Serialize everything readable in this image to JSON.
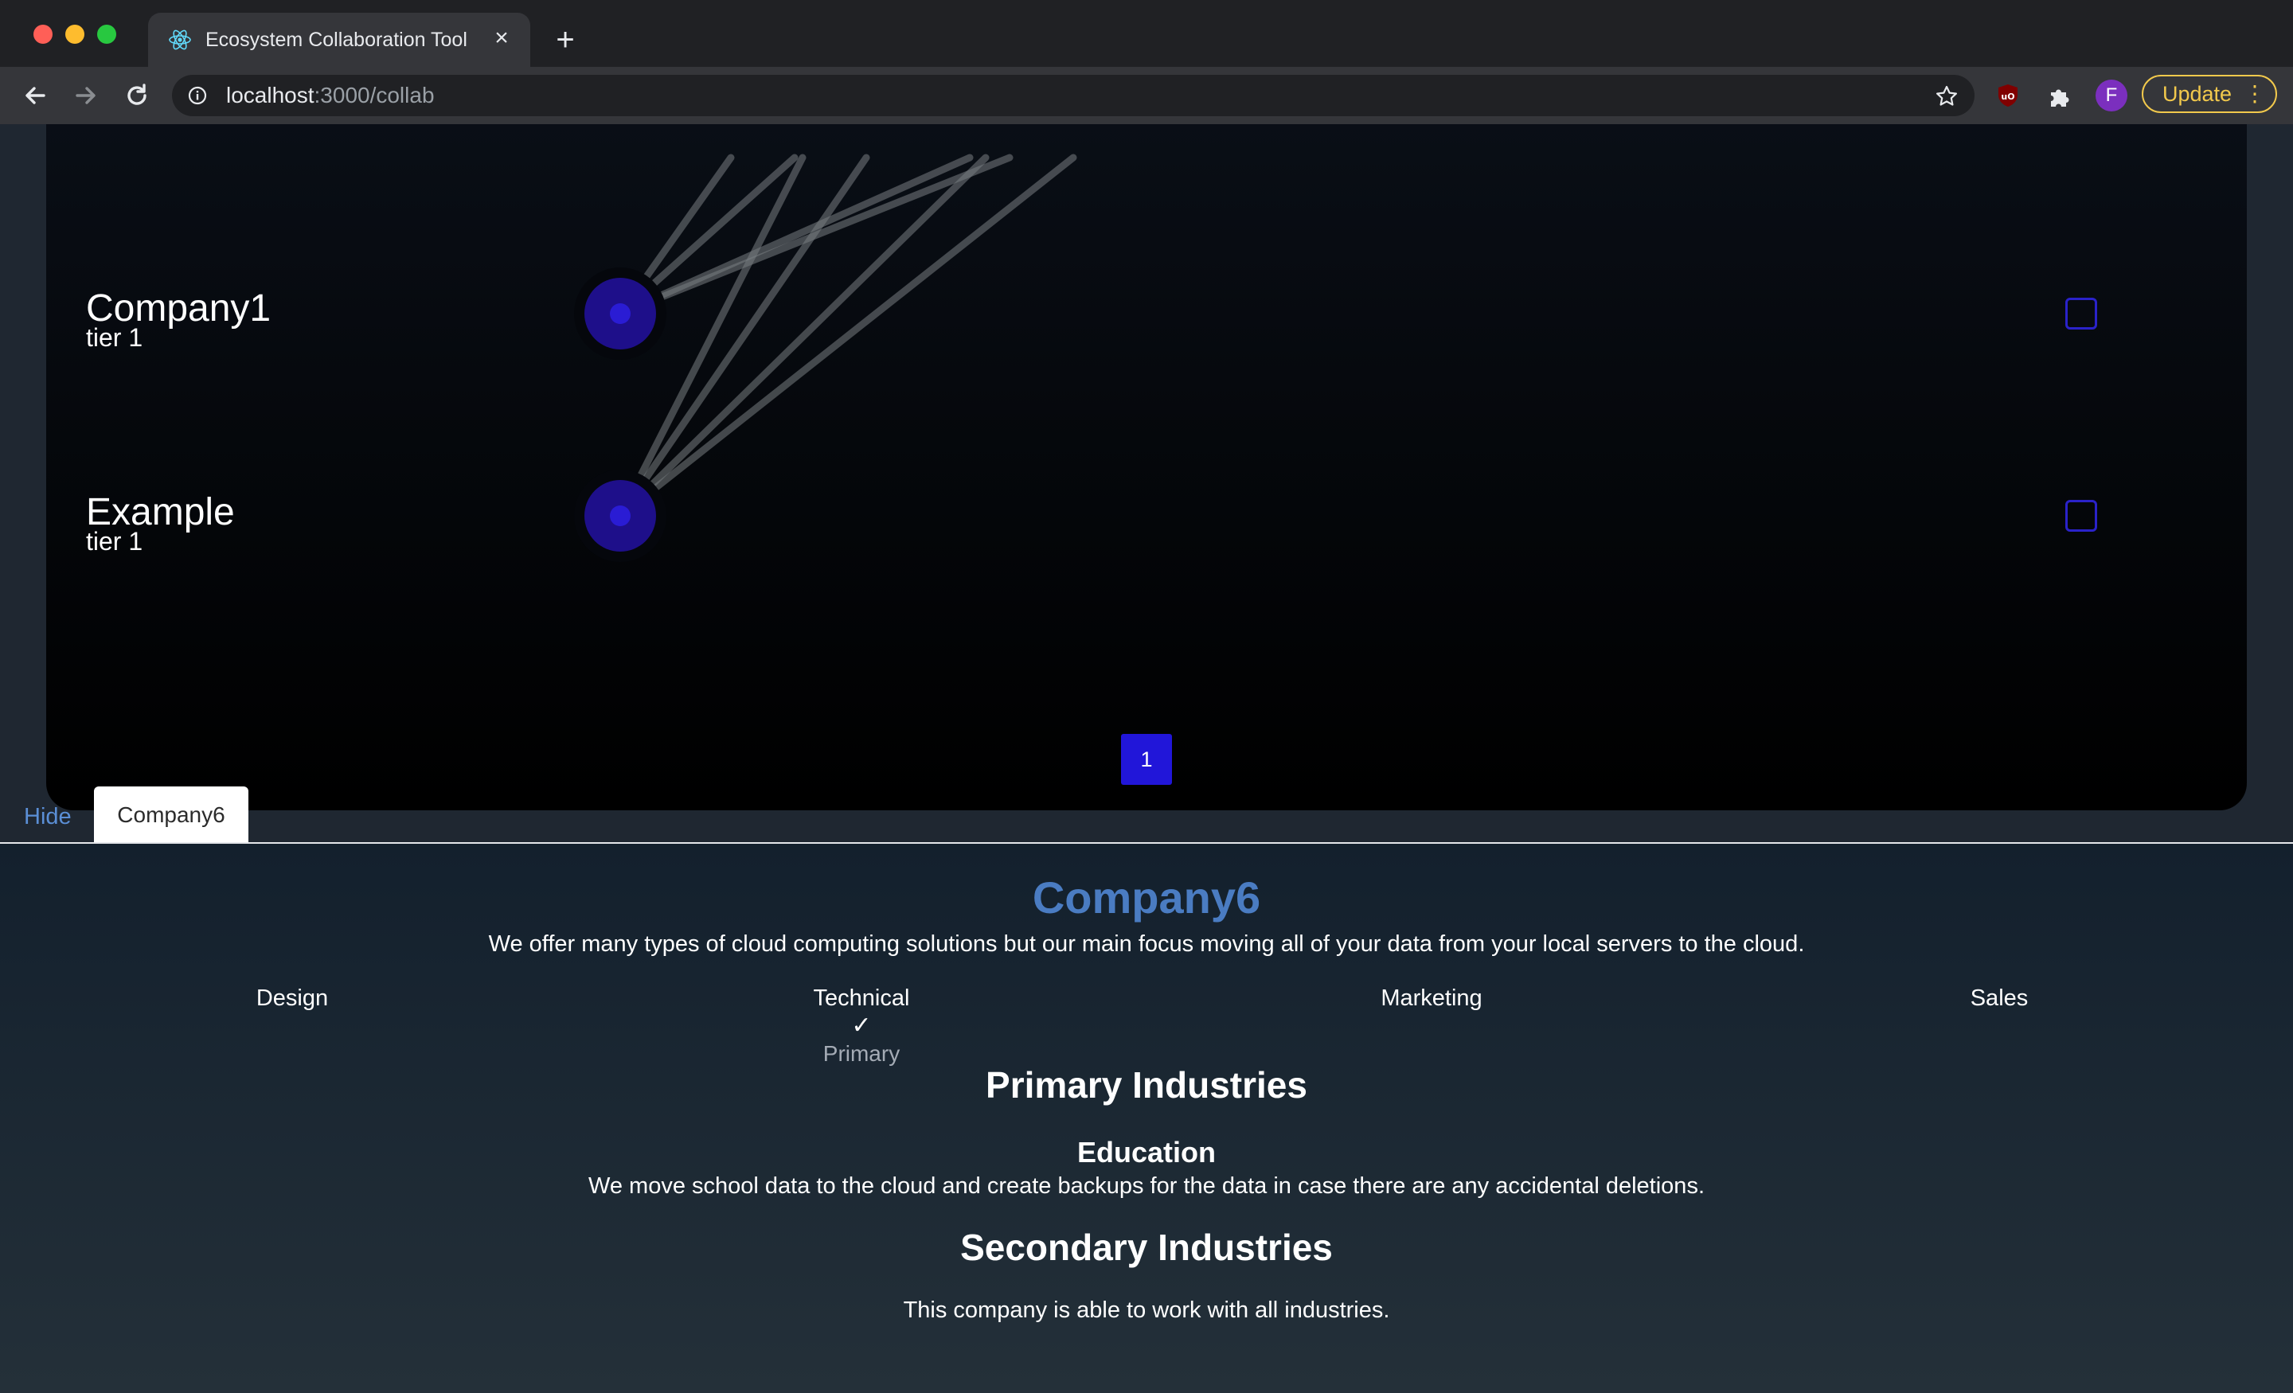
{
  "browser": {
    "tab_title": "Ecosystem Collaboration Tool",
    "url_host": "localhost",
    "url_rest": ":3000/collab",
    "profile_initial": "F",
    "update_label": "Update",
    "icons": [
      "react-favicon",
      "close-icon",
      "plus-icon",
      "back-arrow-icon",
      "forward-arrow-icon",
      "reload-icon",
      "info-icon",
      "star-icon",
      "ublock-icon",
      "puzzle-icon",
      "more-vert-icon"
    ]
  },
  "graph": {
    "nodes": [
      {
        "name": "Company1",
        "tier": "tier 1",
        "checked": false
      },
      {
        "name": "Example",
        "tier": "tier 1",
        "checked": false
      }
    ],
    "node_color": "#1e0f8a",
    "node_center_color": "#2a1cd4",
    "checkbox_color": "#2a22c9"
  },
  "pagination": {
    "pages": [
      "1"
    ],
    "current": "1",
    "color": "#2116d9"
  },
  "tabs": {
    "hide_label": "Hide",
    "active_tab": "Company6"
  },
  "company": {
    "name": "Company6",
    "description": "We offer many types of cloud computing solutions but our main focus moving all of your data from your local servers to the cloud.",
    "categories": [
      {
        "label": "Design",
        "checked": false,
        "note": ""
      },
      {
        "label": "Technical",
        "checked": true,
        "check": "✓",
        "note": "Primary"
      },
      {
        "label": "Marketing",
        "checked": false,
        "note": ""
      },
      {
        "label": "Sales",
        "checked": false,
        "note": ""
      }
    ],
    "primary_heading": "Primary Industries",
    "primary_industries": [
      {
        "name": "Education",
        "description": "We move school data to the cloud and create backups for the data in case there are any accidental deletions."
      }
    ],
    "secondary_heading": "Secondary Industries",
    "secondary_note": "This company is able to work with all industries."
  }
}
